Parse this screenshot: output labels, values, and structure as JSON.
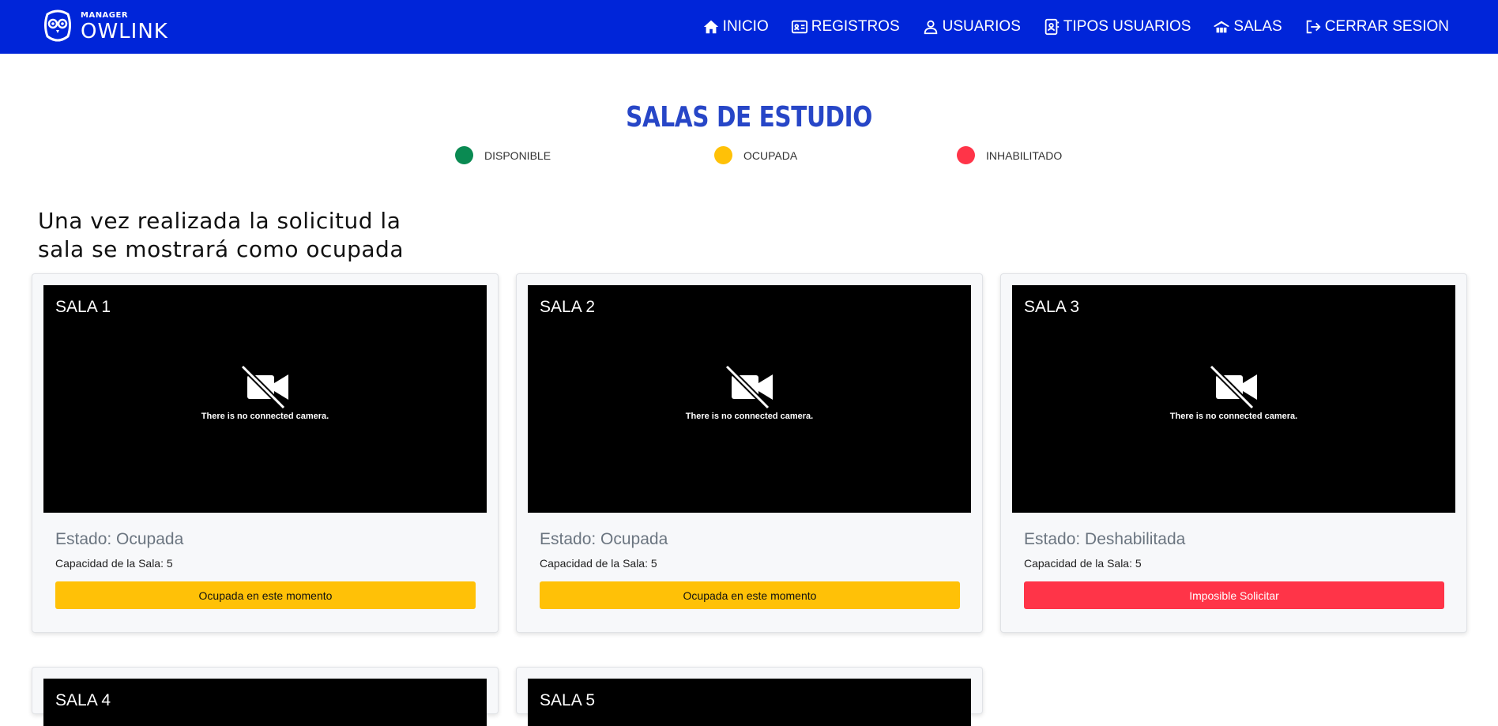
{
  "brand": {
    "small": "MANAGER",
    "big": "OWLINK"
  },
  "nav": [
    {
      "label": "INICIO",
      "icon": "home-icon"
    },
    {
      "label": "REGISTROS",
      "icon": "id-card-icon"
    },
    {
      "label": "USUARIOS",
      "icon": "user-icon"
    },
    {
      "label": "TIPOS USUARIOS",
      "icon": "contact-book-icon"
    },
    {
      "label": "SALAS",
      "icon": "rooms-icon"
    },
    {
      "label": "CERRAR SESION",
      "icon": "logout-icon"
    }
  ],
  "title": "SALAS DE ESTUDIO",
  "legend": [
    {
      "label": "DISPONIBLE",
      "color": "#0a8a52"
    },
    {
      "label": "OCUPADA",
      "color": "#ffc107"
    },
    {
      "label": "INHABILITADO",
      "color": "#ff3448"
    }
  ],
  "notice": "Una vez realizada la solicitud la sala se mostrará como ocupada",
  "cards": [
    {
      "name": "SALA 1",
      "camera_msg": "There is no connected camera.",
      "estado": "Estado: Ocupada",
      "capacidad": "Capacidad de la Sala: 5",
      "button": "Ocupada en este momento"
    },
    {
      "name": "SALA 2",
      "camera_msg": "There is no connected camera.",
      "estado": "Estado: Ocupada",
      "capacidad": "Capacidad de la Sala: 5",
      "button": "Ocupada en este momento"
    },
    {
      "name": "SALA 3",
      "camera_msg": "There is no connected camera.",
      "estado": "Estado: Deshabilitada",
      "capacidad": "Capacidad de la Sala: 5",
      "button": "Imposible Solicitar"
    },
    {
      "name": "SALA 4"
    },
    {
      "name": "SALA 5"
    }
  ]
}
